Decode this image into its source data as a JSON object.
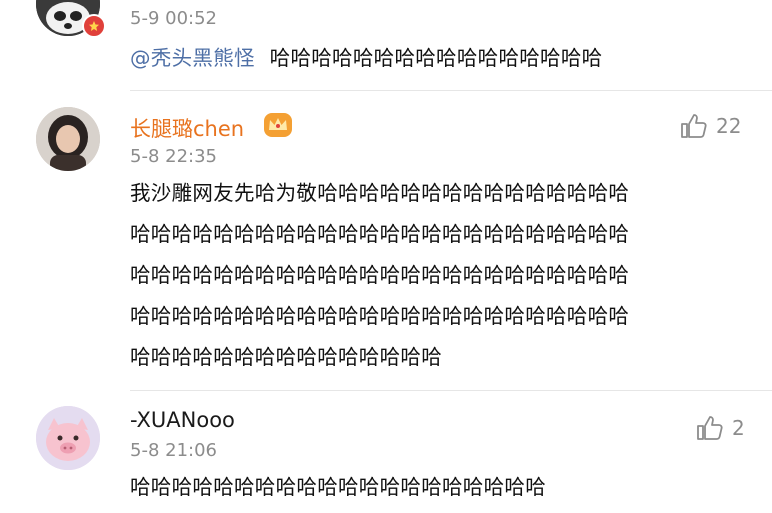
{
  "comments": [
    {
      "time": "5-9 00:52",
      "mention": "@秃头黑熊怪",
      "text": "哈哈哈哈哈哈哈哈哈哈哈哈哈哈哈哈"
    },
    {
      "username": "长腿璐chen",
      "time": "5-8 22:35",
      "likes": "22",
      "lines": [
        "我沙雕网友先哈为敬哈哈哈哈哈哈哈哈哈哈哈哈哈哈哈",
        "哈哈哈哈哈哈哈哈哈哈哈哈哈哈哈哈哈哈哈哈哈哈哈哈",
        "哈哈哈哈哈哈哈哈哈哈哈哈哈哈哈哈哈哈哈哈哈哈哈哈",
        "哈哈哈哈哈哈哈哈哈哈哈哈哈哈哈哈哈哈哈哈哈哈哈哈",
        "哈哈哈哈哈哈哈哈哈哈哈哈哈哈哈"
      ]
    },
    {
      "username": "-XUANooo",
      "time": "5-8 21:06",
      "likes": "2",
      "text": "哈哈哈哈哈哈哈哈哈哈哈哈哈哈哈哈哈哈哈哈"
    }
  ],
  "colors": {
    "username": "#e8731f",
    "mention": "#4e6fa6",
    "time": "#8c8c8c",
    "badge": "#e0403a"
  },
  "icons": [
    "panda-avatar",
    "vip-badge-icon",
    "crown-icon",
    "thumbs-up-icon",
    "pig-avatar"
  ]
}
